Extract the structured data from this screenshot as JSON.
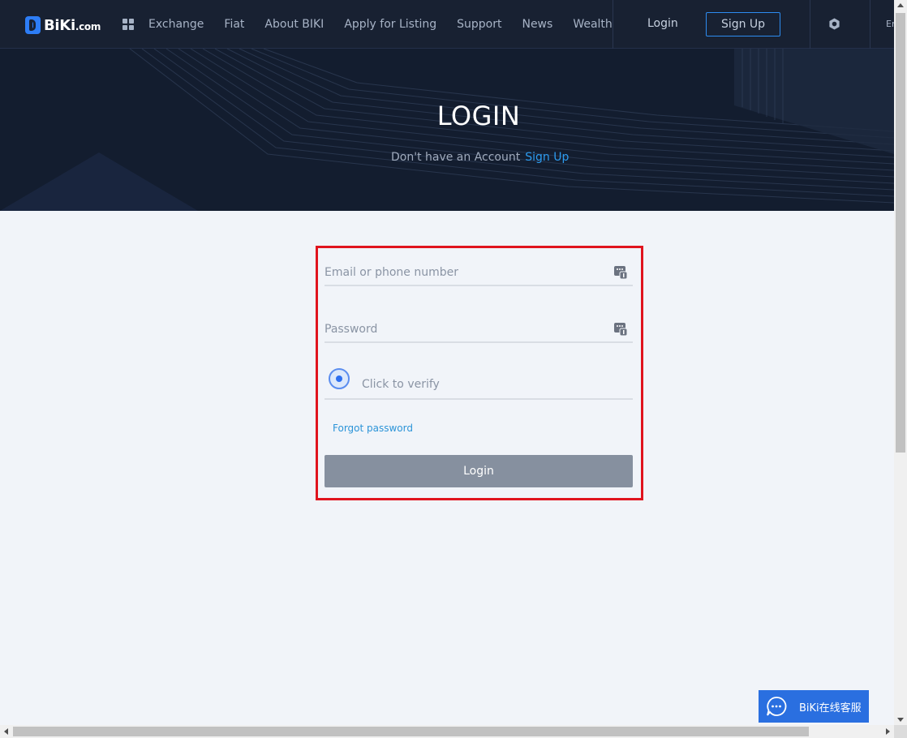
{
  "header": {
    "logo_text": "BiKi",
    "logo_suffix": ".com",
    "nav": [
      "Exchange",
      "Fiat",
      "About BIKI",
      "Apply for Listing",
      "Support",
      "News",
      "Wealth"
    ],
    "login_label": "Login",
    "signup_label": "Sign Up",
    "lang_label": "En"
  },
  "banner": {
    "title": "LOGIN",
    "prompt": "Don't have an Account",
    "signup_link": "Sign Up"
  },
  "form": {
    "email_placeholder": "Email or phone number",
    "password_placeholder": "Password",
    "verify_label": "Click to verify",
    "forgot_label": "Forgot password",
    "submit_label": "Login"
  },
  "chat": {
    "label": "BiKi在线客服"
  },
  "colors": {
    "header_bg": "#182132",
    "banner_bg": "#131d2f",
    "page_bg": "#f1f4f9",
    "accent": "#2d8cf0",
    "highlight_outline": "#e0141e",
    "button_disabled": "#86909f",
    "chat_bg": "#2a6fe0"
  },
  "icons": {
    "grid": "grid-icon",
    "settings": "settings-icon",
    "email_field": "key-icon",
    "password_field": "key-icon",
    "chat": "chat-bubble-icon"
  }
}
